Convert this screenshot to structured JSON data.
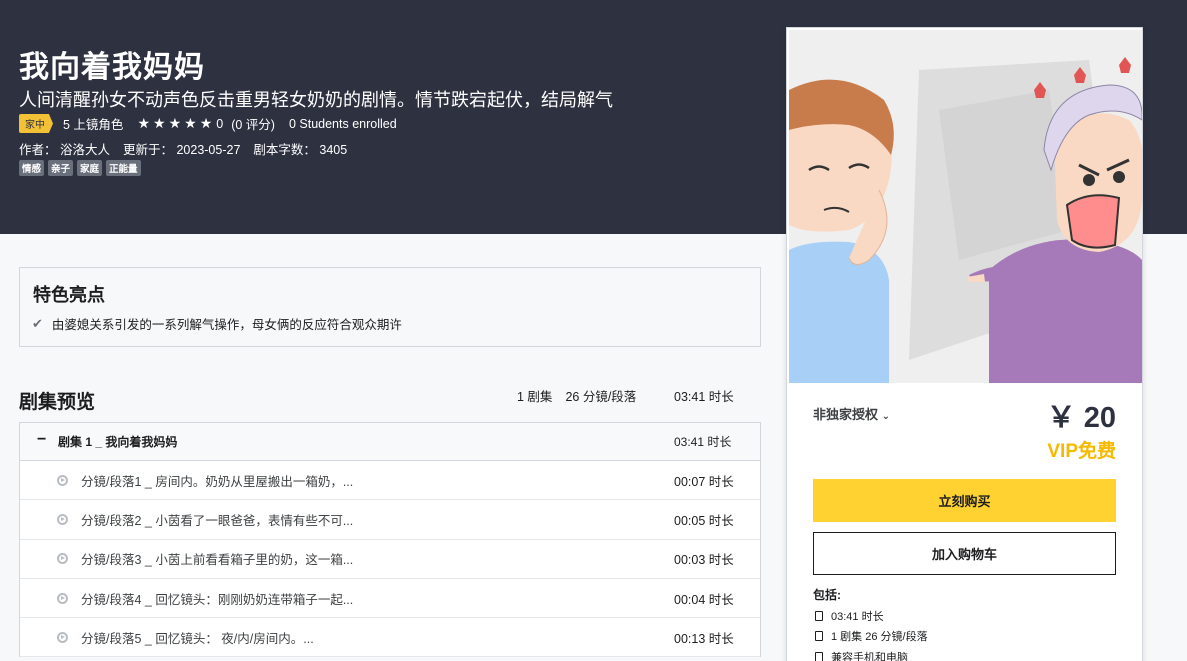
{
  "course": {
    "title": "我向着我妈妈",
    "subtitle": "人间清醒孙女不动声色反击重男轻女奶奶的剧情。情节跌宕起伏，结局解气",
    "badge": "家中",
    "roles": "5 上镜角色",
    "rating": "0",
    "rating_count": "(0 评分)",
    "students": "0 Students enrolled",
    "author": "作者：  浴洛大人",
    "updated": "更新于：  2023-05-27",
    "word_count": "剧本字数：  3405",
    "tags": [
      "情感",
      "亲子",
      "家庭",
      "正能量"
    ]
  },
  "highlights": {
    "title": "特色亮点",
    "items": [
      "由婆媳关系引发的一系列解气操作，母女俩的反应符合观众期许"
    ]
  },
  "preview": {
    "title": "剧集预览",
    "episodes_count": "1 剧集",
    "segments_count": "26 分镜/段落",
    "total_duration": "03:41 时长",
    "section": {
      "label": "剧集 1 _ 我向着我妈妈",
      "duration": "03:41 时长"
    },
    "rows": [
      {
        "label": "分镜/段落1 _ 房间内。奶奶从里屋搬出一箱奶，...",
        "duration": "00:07 时长"
      },
      {
        "label": "分镜/段落2 _ 小茵看了一眼爸爸，表情有些不可...",
        "duration": "00:05 时长"
      },
      {
        "label": "分镜/段落3 _ 小茵上前看看箱子里的奶，这一箱...",
        "duration": "00:03 时长"
      },
      {
        "label": "分镜/段落4 _ 回忆镜头：刚刚奶奶连带箱子一起...",
        "duration": "00:04 时长"
      },
      {
        "label": "分镜/段落5 _ 回忆镜头：  夜/内/房间内。...",
        "duration": "00:13 时长"
      }
    ]
  },
  "card": {
    "license": "非独家授权",
    "price": "￥ 20",
    "vip": "VIP免费",
    "buy_label": "立刻购买",
    "cart_label": "加入购物车",
    "includes_title": "包括:",
    "includes": [
      "03:41 时长",
      "1 剧集 26 分镜/段落",
      "兼容手机和电脑"
    ]
  },
  "icons": {
    "check": "check-icon",
    "star": "star-icon",
    "play": "play-circle-icon",
    "collapse": "minus-icon",
    "chevron": "chevron-down-icon"
  },
  "colors": {
    "hero_bg": "#2d3140",
    "accent_yellow": "#ffd231",
    "vip_color": "#f5b900"
  }
}
